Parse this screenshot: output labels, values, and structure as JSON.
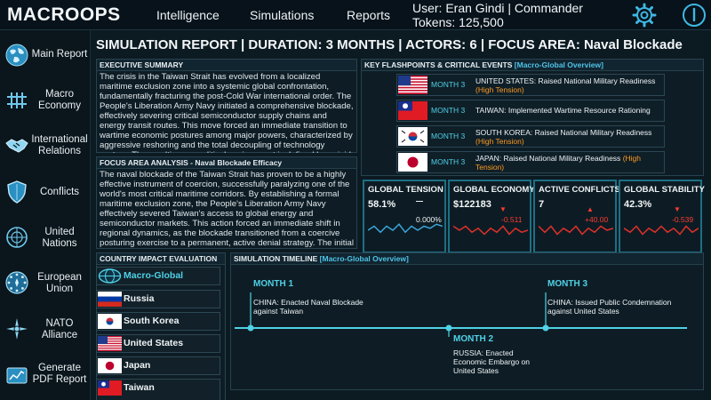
{
  "app": {
    "brand": "MACROOPS"
  },
  "nav": [
    {
      "label": "Intelligence"
    },
    {
      "label": "Simulations"
    },
    {
      "label": "Reports"
    }
  ],
  "user": {
    "line": "User: Eran Gindi | Commander",
    "tokens": "Tokens: 125,500"
  },
  "top_icons": [
    "gear-icon",
    "power-icon"
  ],
  "sidebar": {
    "items": [
      {
        "label": "Main Report",
        "icon": "globe-icon"
      },
      {
        "label": "Macro Economy",
        "icon": "economy-grid-icon"
      },
      {
        "label": "International Relations",
        "icon": "handshake-icon"
      },
      {
        "label": "Conflicts",
        "icon": "shield-icon"
      },
      {
        "label": "United Nations",
        "icon": "un-emblem-icon"
      },
      {
        "label": "European Union",
        "icon": "eu-star-circle-icon"
      },
      {
        "label": "NATO Alliance",
        "icon": "nato-compass-icon"
      },
      {
        "label": "Generate PDF Report",
        "icon": "pdf-report-icon"
      }
    ]
  },
  "report": {
    "title": "SIMULATION REPORT | DURATION: 3 MONTHS | ACTORS: 6 | FOCUS AREA: Naval Blockade"
  },
  "executive_summary": {
    "heading": "EXECUTIVE SUMMARY",
    "text": "The crisis in the Taiwan Strait has evolved from a localized maritime exclusion zone into a systemic global confrontation, fundamentally fracturing the post-Cold War international order. The People's Liberation Army Navy initiated a comprehensive blockade, effectively severing critical semiconductor supply chains and energy transit routes. This move forced an immediate transition to wartime economic postures among major powers, characterized by aggressive reshoring and the total decoupling of technology sectors. The resulting geopolitical environment is defined by a rigid, binary alignment"
  },
  "focus_analysis": {
    "heading": "FOCUS AREA ANALYSIS - Naval Blockade Efficacy",
    "text": "The naval blockade of the Taiwan Strait has proven to be a highly effective instrument of coercion, successfully paralyzing one of the world's most critical maritime corridors. By establishing a formal maritime exclusion zone, the People's Liberation Army Navy effectively severed Taiwan's access to global energy and semiconductor markets. This action forced an immediate shift in regional dynamics, as the blockade transitioned from a coercive posturing exercise to a permanent, active denial strategy. The initial impact was a total disruption of commercial shipping, forcing"
  },
  "flashpoints": {
    "heading": "KEY FLASHPOINTS & CRITICAL EVENTS",
    "heading_tag": "[Macro-Global Overview]",
    "events": [
      {
        "flag": "us-flag-icon",
        "month": "MONTH 3",
        "text": "UNITED STATES: Raised National Military Readiness",
        "tension": "(High Tension)"
      },
      {
        "flag": "taiwan-flag-icon",
        "month": "MONTH 3",
        "text": "TAIWAN: Implemented Wartime Resource Rationing",
        "tension": ""
      },
      {
        "flag": "south-korea-flag-icon",
        "month": "MONTH 3",
        "text": "SOUTH KOREA: Raised National Military Readiness",
        "tension": "(High Tension)"
      },
      {
        "flag": "japan-flag-icon",
        "month": "MONTH 3",
        "text": "JAPAN: Raised National Military Readiness",
        "tension": "(High Tension)"
      }
    ]
  },
  "metrics": [
    {
      "title": "GLOBAL TENSION",
      "value": "58.1%",
      "delta": "0.000%",
      "direction": "flat",
      "sparkline": [
        4,
        6,
        3,
        6,
        4,
        7,
        3,
        6,
        4,
        6,
        5,
        7,
        6
      ]
    },
    {
      "title": "GLOBAL ECONOMY",
      "value": "$122183",
      "delta": "-0.511",
      "direction": "down",
      "sparkline": [
        6,
        4,
        6,
        3,
        5,
        2,
        5,
        3,
        6,
        2,
        5,
        3,
        4
      ]
    },
    {
      "title": "ACTIVE CONFLICTS",
      "value": "7",
      "delta": "+40.00",
      "direction": "up",
      "sparkline": [
        6,
        3,
        6,
        2,
        5,
        3,
        6,
        2,
        5,
        3,
        6,
        4,
        5
      ]
    },
    {
      "title": "GLOBAL STABILITY",
      "value": "42.3%",
      "delta": "-0.539",
      "direction": "down",
      "sparkline": [
        5,
        3,
        6,
        2,
        5,
        3,
        6,
        3,
        5,
        2,
        6,
        3,
        5
      ]
    }
  ],
  "country_impact": {
    "heading": "COUNTRY IMPACT EVALUATION",
    "countries": [
      {
        "name": "Macro-Global",
        "icon": "globe-icon",
        "active": true
      },
      {
        "name": "Russia",
        "icon": "russia-flag-icon"
      },
      {
        "name": "South Korea",
        "icon": "south-korea-flag-icon"
      },
      {
        "name": "United States",
        "icon": "us-flag-icon"
      },
      {
        "name": "Japan",
        "icon": "japan-flag-icon"
      },
      {
        "name": "Taiwan",
        "icon": "taiwan-flag-icon"
      }
    ]
  },
  "timeline": {
    "heading": "SIMULATION TIMELINE",
    "heading_tag": "[Macro-Global Overview]",
    "events": [
      {
        "month": "MONTH 1",
        "text": "CHINA: Enacted Naval Blockade against Taiwan"
      },
      {
        "month": "MONTH 2",
        "text": "RUSSIA: Enacted Economic Embargo on United States"
      },
      {
        "month": "MONTH 3",
        "text": "CHINA: Issued Public Condemnation against United States"
      }
    ]
  },
  "colors": {
    "accent": "#4fd1e6",
    "tension": "#ff9a1f",
    "negative": "#ff3b30",
    "sparkline": "#3aa6d8",
    "sparkline_negative": "#e0302a"
  }
}
